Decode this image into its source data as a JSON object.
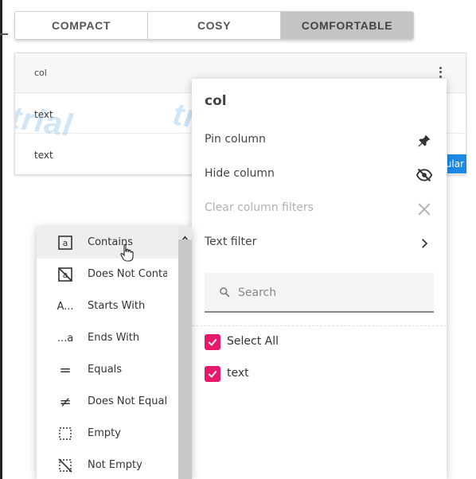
{
  "density": {
    "options": [
      "COMPACT",
      "COSY",
      "COMFORTABLE"
    ],
    "selected": "COMFORTABLE"
  },
  "grid": {
    "column_header": "col",
    "rows": [
      "text",
      "text"
    ],
    "watermark": "trial",
    "side_tag": "ular"
  },
  "column_menu": {
    "title": "col",
    "items": [
      {
        "label": "Pin column",
        "icon": "pin-icon",
        "disabled": false
      },
      {
        "label": "Hide column",
        "icon": "eye-off-icon",
        "disabled": false
      },
      {
        "label": "Clear column filters",
        "icon": "close-icon",
        "disabled": true
      },
      {
        "label": "Text filter",
        "icon": "chevron-right-icon",
        "disabled": false
      }
    ],
    "search_placeholder": "Search",
    "checklist": [
      {
        "label": "Select All",
        "checked": true
      },
      {
        "label": "text",
        "checked": true
      }
    ],
    "accent_color": "#e5186b"
  },
  "filter_options": [
    {
      "label": "Contains",
      "glyph": "a"
    },
    {
      "label": "Does Not Contain",
      "glyph": "a"
    },
    {
      "label": "Starts With",
      "glyph": "A..."
    },
    {
      "label": "Ends With",
      "glyph": "...a"
    },
    {
      "label": "Equals",
      "glyph": "="
    },
    {
      "label": "Does Not Equal",
      "glyph": "≠"
    },
    {
      "label": "Empty",
      "glyph": ""
    },
    {
      "label": "Not Empty",
      "glyph": ""
    }
  ]
}
